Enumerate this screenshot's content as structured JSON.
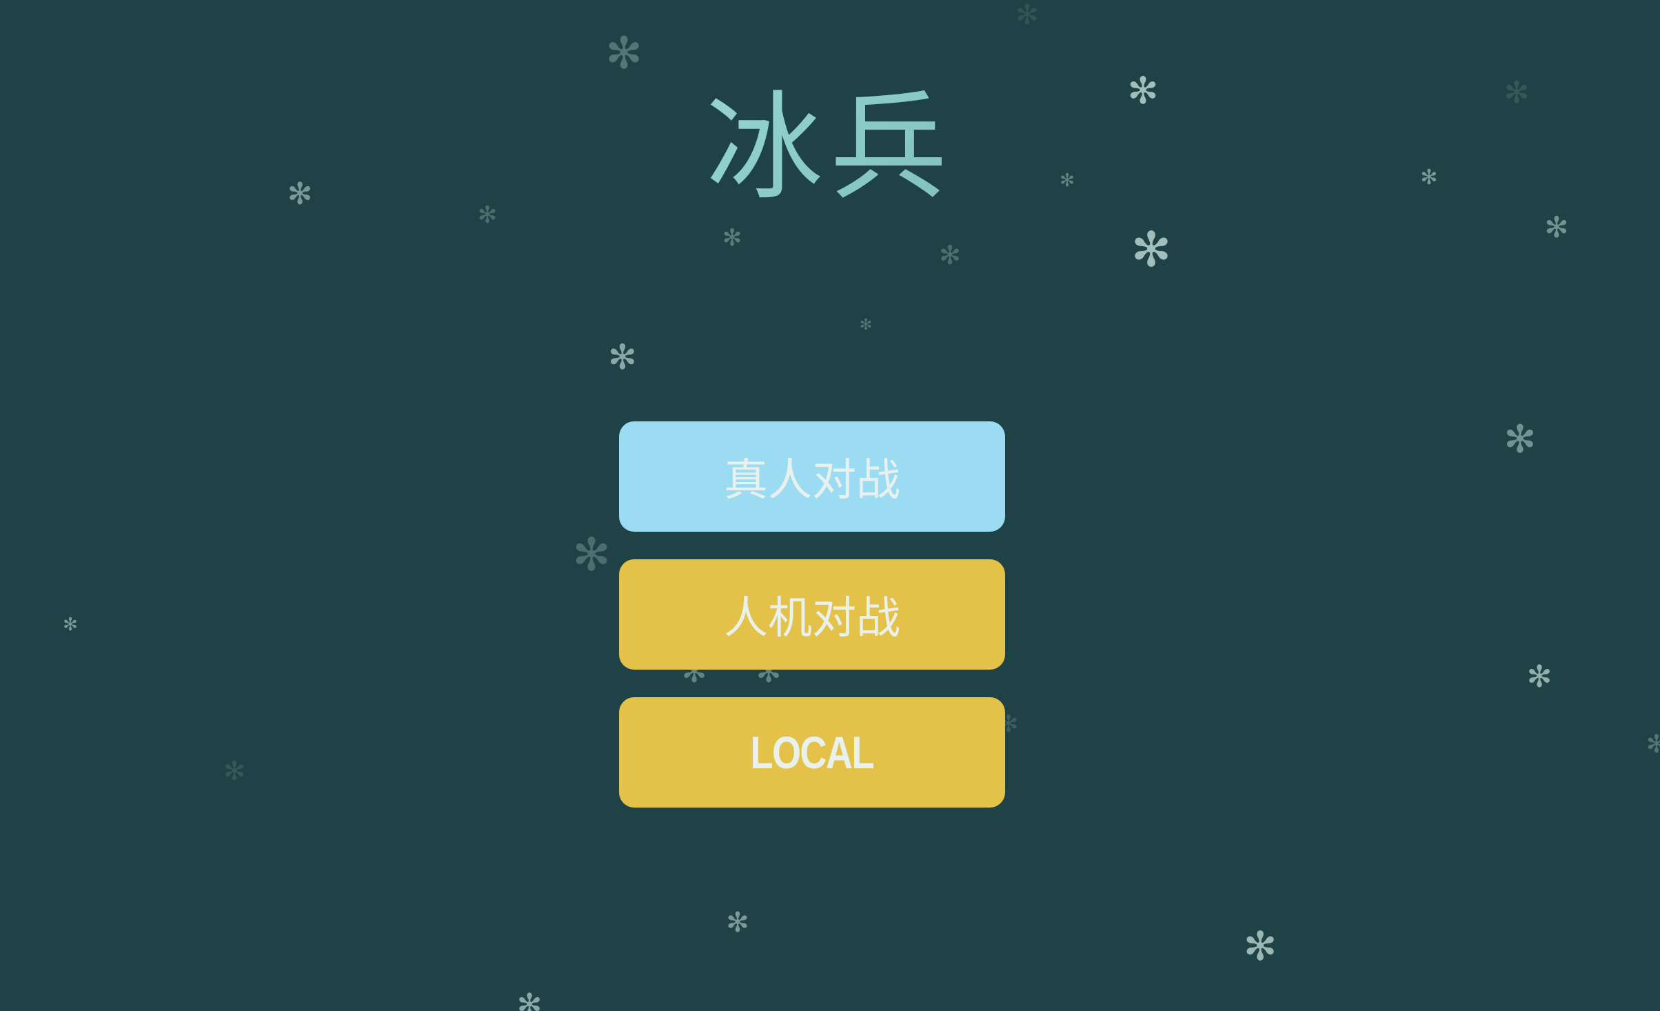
{
  "screen": {
    "background_color": "#1e4245"
  },
  "title": "冰兵",
  "menu": {
    "buttons": [
      {
        "label": "真人对战",
        "color": "#9bdcf3"
      },
      {
        "label": "人机对战",
        "color": "#e4c24a"
      },
      {
        "label": "LOCAL",
        "color": "#e4c24a"
      }
    ]
  },
  "decoration": {
    "snowflake_icon": "snowflake-icon",
    "snowflake_glyph": "✻"
  }
}
